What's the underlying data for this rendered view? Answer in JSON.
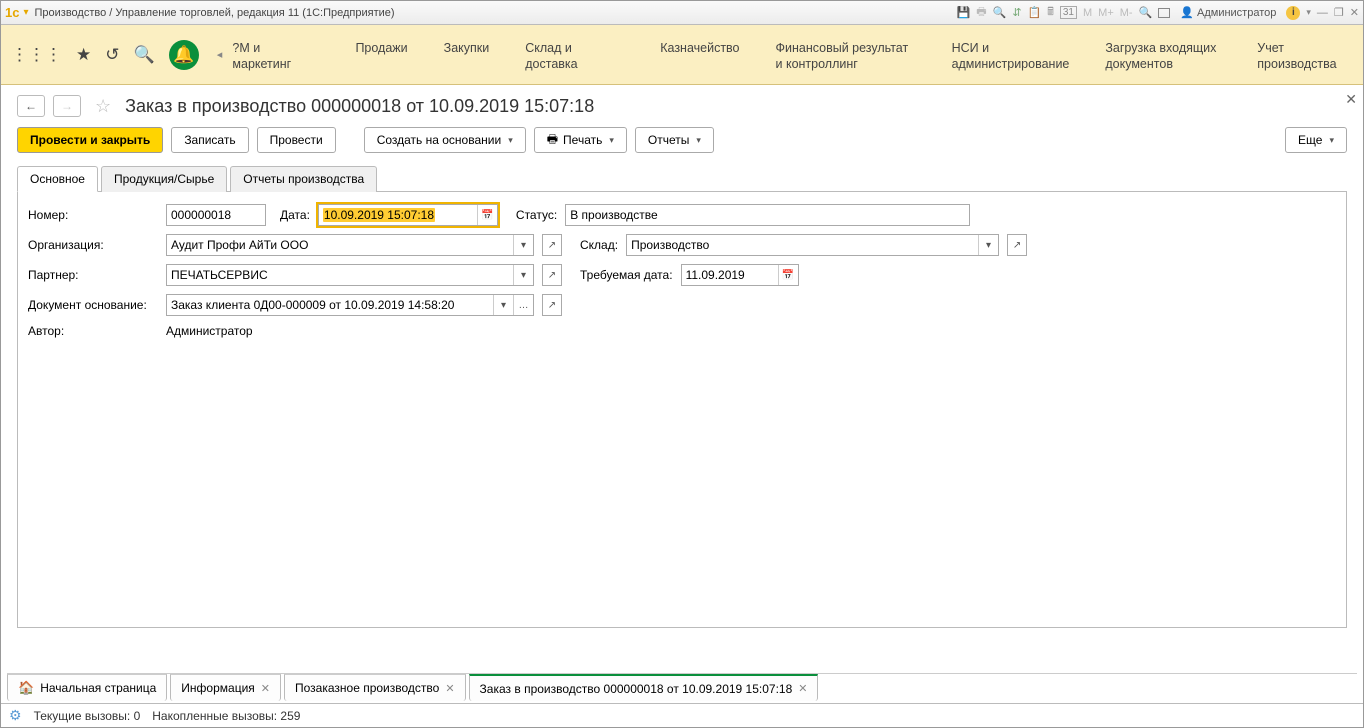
{
  "titlebar": {
    "title": "Производство / Управление торговлей, редакция 11  (1С:Предприятие)",
    "admin_label": "Администратор",
    "m_labels": [
      "M",
      "M+",
      "M-"
    ],
    "cal_num": "31"
  },
  "menubar": {
    "sections": [
      "?М и маркетинг",
      "Продажи",
      "Закупки",
      "Склад и доставка",
      "Казначейство",
      "Финансовый результат и контроллинг",
      "НСИ и администрирование",
      "Загрузка входящих документов",
      "Учет производства"
    ]
  },
  "docheader": {
    "title": "Заказ в производство 000000018 от 10.09.2019 15:07:18"
  },
  "toolbar": {
    "post_close": "Провести и закрыть",
    "save": "Записать",
    "post": "Провести",
    "create_on": "Создать на основании",
    "print": "Печать",
    "reports": "Отчеты",
    "more": "Еще"
  },
  "page_tabs": [
    "Основное",
    "Продукция/Сырье",
    "Отчеты производства"
  ],
  "form": {
    "labels": {
      "number": "Номер:",
      "date": "Дата:",
      "status": "Статус:",
      "organization": "Организация:",
      "warehouse": "Склад:",
      "partner": "Партнер:",
      "required_date": "Требуемая дата:",
      "basis": "Документ основание:",
      "author": "Автор:"
    },
    "values": {
      "number": "000000018",
      "date": "10.09.2019 15:07:18",
      "status": "В производстве",
      "organization": "Аудит Профи АйТи ООО",
      "warehouse": "Производство",
      "partner": "ПЕЧАТЬСЕРВИС",
      "required_date": "11.09.2019",
      "basis": "Заказ клиента 0Д00-000009 от 10.09.2019 14:58:20",
      "author": "Администратор"
    }
  },
  "window_tabs": {
    "home": "Начальная страница",
    "t1": "Информация",
    "t2": "Позаказное производство",
    "t3": "Заказ в производство 000000018 от 10.09.2019 15:07:18"
  },
  "statusbar": {
    "current_calls": "Текущие вызовы: 0",
    "accumulated": "Накопленные вызовы: 259"
  }
}
